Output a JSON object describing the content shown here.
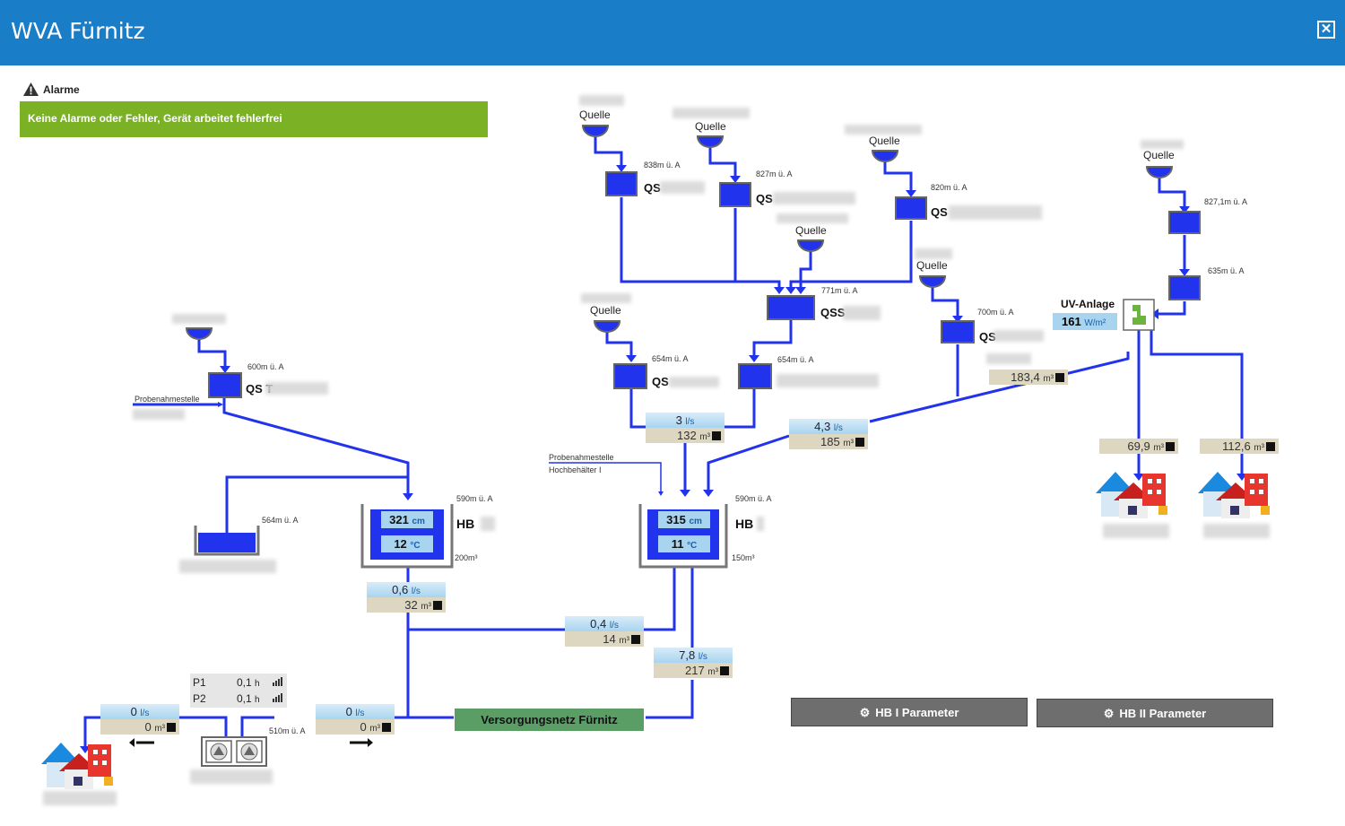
{
  "window": {
    "title": "WVA Fürnitz",
    "close_label": "✕"
  },
  "alarms": {
    "title": "Alarme",
    "status": "Keine Alarme oder Fehler, Gerät arbeitet fehlerfrei"
  },
  "labels": {
    "quelle": "Quelle",
    "probe": "Probenahmestelle",
    "probe2_line1": "Probenahmestelle",
    "probe2_line2": "Hochbehälter I",
    "uv": "UV-Anlage"
  },
  "sources": {
    "qs_a": {
      "alt": "838m ü. A",
      "name": "QS"
    },
    "qs_b": {
      "alt": "827m ü. A",
      "name": "QS"
    },
    "qs_c": {
      "alt": "820m ü. A",
      "name": "QS"
    },
    "qs_d": {
      "alt": "827,1m ü. A"
    },
    "qs_e": {
      "alt": "635m ü. A"
    },
    "qss": {
      "alt": "771m ü. A",
      "name": "QSS"
    },
    "qs_f": {
      "alt": "700m ü. A",
      "name": "QS"
    },
    "qs_g": {
      "alt": "654m ü. A",
      "name": "QS"
    },
    "qs_h": {
      "alt": "654m ü. A"
    },
    "qs_t": {
      "alt": "600m ü. A",
      "name": "QS T"
    },
    "tank_564": {
      "alt": "564m ü. A"
    },
    "pump_510": {
      "alt": "510m ü. A"
    }
  },
  "hb1": {
    "alt": "590m ü. A",
    "name": "HB",
    "level": "321",
    "level_unit": "cm",
    "temp": "12",
    "temp_unit": "°C",
    "volume": "200m³"
  },
  "hb2": {
    "alt": "590m ü. A",
    "name": "HB",
    "level": "315",
    "level_unit": "cm",
    "temp": "11",
    "temp_unit": "°C",
    "volume": "150m³"
  },
  "uv": {
    "value": "161",
    "unit": "W/m²"
  },
  "flows": {
    "f_3": {
      "rate": "3",
      "rate_unit": "l/s",
      "total": "132",
      "total_unit": "m³"
    },
    "f_43": {
      "rate": "4,3",
      "rate_unit": "l/s",
      "total": "185",
      "total_unit": "m³"
    },
    "f_06": {
      "rate": "0,6",
      "rate_unit": "l/s",
      "total": "32",
      "total_unit": "m³"
    },
    "f_04": {
      "rate": "0,4",
      "rate_unit": "l/s",
      "total": "14",
      "total_unit": "m³"
    },
    "f_78": {
      "rate": "7,8",
      "rate_unit": "l/s",
      "total": "217",
      "total_unit": "m³"
    },
    "f_0a": {
      "rate": "0",
      "rate_unit": "l/s",
      "total": "0",
      "total_unit": "m³"
    },
    "f_0b": {
      "rate": "0",
      "rate_unit": "l/s",
      "total": "0",
      "total_unit": "m³"
    }
  },
  "meters": {
    "m_1834": {
      "total": "183,4",
      "unit": "m³"
    },
    "m_699": {
      "total": "69,9",
      "unit": "m³"
    },
    "m_1126": {
      "total": "112,6",
      "unit": "m³"
    }
  },
  "pumps": [
    {
      "name": "P1",
      "hours": "0,1",
      "unit": "h"
    },
    {
      "name": "P2",
      "hours": "0,1",
      "unit": "h"
    }
  ],
  "network": {
    "label": "Versorgungsnetz Fürnitz"
  },
  "buttons": {
    "hb1": "HB I Parameter",
    "hb2": "HB II Parameter"
  },
  "colors": {
    "header": "#1a7dc8",
    "pipe": "#2233ee",
    "alarm_ok": "#7ab125",
    "network": "#5a9e66"
  }
}
